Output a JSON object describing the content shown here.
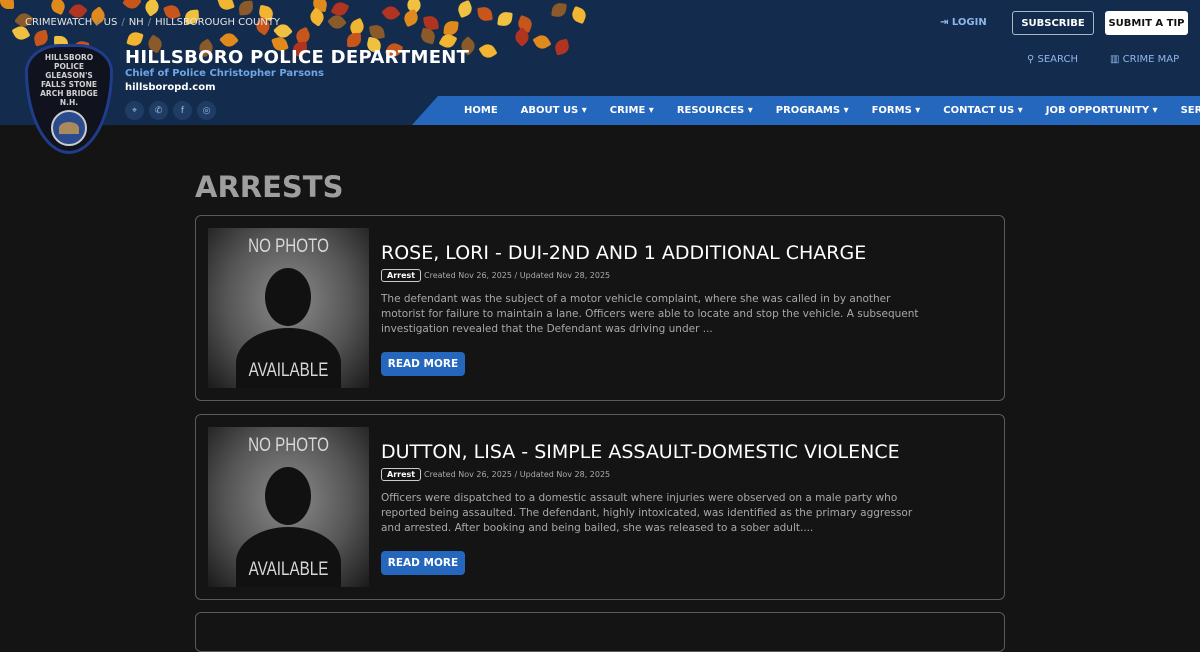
{
  "breadcrumb": [
    "CRIMEWATCH",
    "US",
    "NH",
    "HILLSBOROUGH COUNTY"
  ],
  "header": {
    "title": "HILLSBORO POLICE DEPARTMENT",
    "chief": "Chief of Police Christopher Parsons",
    "url": "hillsboropd.com",
    "badge_text": "HILLSBORO POLICE GLEASON'S FALLS STONE ARCH BRIDGE N.H."
  },
  "top": {
    "login": "LOGIN",
    "subscribe": "SUBSCRIBE",
    "tip": "SUBMIT A TIP",
    "search": "SEARCH",
    "crime_map": "CRIME MAP"
  },
  "nav": [
    "HOME",
    "ABOUT US ▾",
    "CRIME ▾",
    "RESOURCES ▾",
    "PROGRAMS ▾",
    "FORMS ▾",
    "CONTACT US ▾",
    "JOB OPPORTUNITY ▾",
    "SERVICES ▾"
  ],
  "page_title": "ARRESTS",
  "photo": {
    "top": "NO PHOTO",
    "bottom": "AVAILABLE"
  },
  "arrests": [
    {
      "title": "ROSE, LORI - DUI-2ND AND 1 ADDITIONAL CHARGE",
      "tag": "Arrest",
      "dates": "Created Nov 26, 2025 / Updated Nov 28, 2025",
      "desc": "The defendant was the subject of a motor vehicle complaint, where she was called in by another motorist for failure to maintain a lane.  Officers were able to locate and stop the vehicle.  A subsequent investigation revealed that the Defendant was driving under ...",
      "button": "READ MORE"
    },
    {
      "title": "DUTTON, LISA - SIMPLE ASSAULT-DOMESTIC VIOLENCE",
      "tag": "Arrest",
      "dates": "Created Nov 26, 2025 / Updated Nov 28, 2025",
      "desc": "Officers were dispatched to a domestic assault where injuries were observed on a male party who reported being assaulted. The defendant, highly intoxicated, was identified as the primary aggressor and arrested. After booking and being bailed, she was released to a sober adult....",
      "button": "READ MORE"
    }
  ]
}
